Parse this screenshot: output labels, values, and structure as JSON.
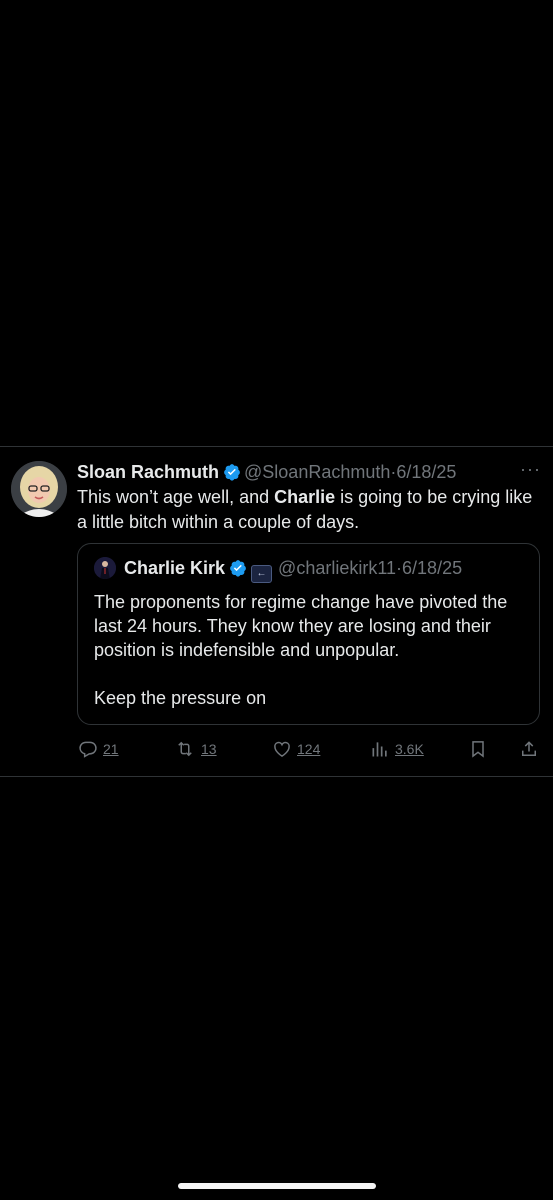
{
  "tweet": {
    "author_name": "Sloan Rachmuth",
    "author_handle": "@SloanRachmuth",
    "separator": "·",
    "date": "6/18/25",
    "more_label": "···",
    "text_before": "This won’t age well, and ",
    "text_bold": "Charlie",
    "text_after": " is going to be crying like a little bitch within a couple of days."
  },
  "quote": {
    "author_name": "Charlie Kirk",
    "author_handle": "@charliekirk11",
    "separator": "·",
    "date": "6/18/25",
    "paragraph_1": "The proponents for regime change have pivoted the last 24 hours. They know they are losing and their position is indefensible and unpopular.",
    "paragraph_2": "Keep the pressure on"
  },
  "actions": {
    "replies": "21",
    "reposts": "13",
    "likes": "124",
    "views": "3.6K"
  },
  "colors": {
    "background": "#000000",
    "text": "#e7e9ea",
    "muted": "#71767b",
    "verified": "#1d9bf0",
    "divider": "#2f3336"
  }
}
